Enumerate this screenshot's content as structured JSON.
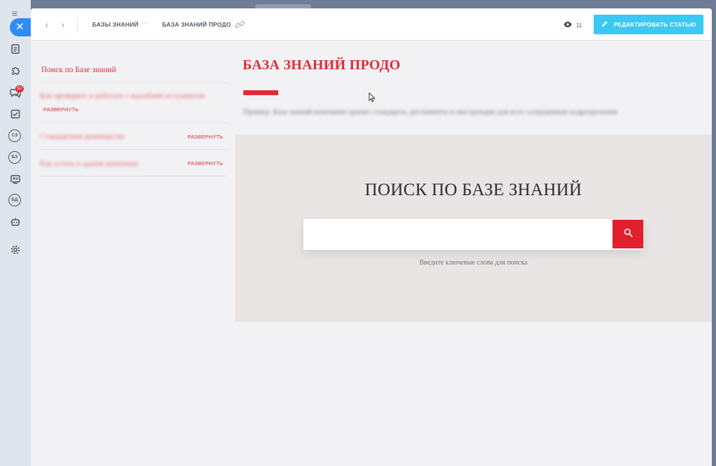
{
  "sidebar": {
    "chat_badge": "62",
    "items": [
      {
        "icon": "menu-icon"
      },
      {
        "icon": "close-icon"
      },
      {
        "icon": "document-icon"
      },
      {
        "icon": "puzzle-icon"
      },
      {
        "icon": "chat-icon"
      },
      {
        "icon": "tasks-icon"
      },
      {
        "label": "СЗ"
      },
      {
        "label": "БЗ"
      },
      {
        "icon": "contact-center-icon"
      },
      {
        "label": "БД"
      },
      {
        "icon": "robot-icon"
      },
      {
        "icon": "settings-icon"
      }
    ]
  },
  "topbar": {
    "breadcrumb": [
      "БАЗЫ ЗНАНИЙ",
      "БАЗА ЗНАНИЙ ПРОДО"
    ],
    "views_count": "11",
    "edit_button_label": "РЕДАКТИРОВАТЬ СТАТЬЮ"
  },
  "menu": {
    "items": [
      {
        "label": "Поиск по Базе знаний"
      },
      {
        "label": "Как проверять и работать с жалобами из клиентов",
        "action": "РАЗВЕРНУТЬ"
      },
      {
        "label": "Стандартные руководства",
        "action": "РАЗВЕРНУТЬ"
      },
      {
        "label": "Как устать в здание компании",
        "action": "РАЗВЕРНУТЬ"
      }
    ]
  },
  "article": {
    "title": "БАЗА ЗНАНИЙ ПРОДО",
    "description": "Пример: База знаний компании хранит стандарты, регламенты и инструкции для всех сотрудников подразделения"
  },
  "search": {
    "title": "ПОИСК ПО БАЗЕ ЗНАНИЙ",
    "placeholder": "",
    "hint": "Введите ключевые слова для поиска"
  },
  "colors": {
    "accent_red": "#e02b36",
    "edit_button": "#3bc8f5",
    "close_button": "#2f8cf5"
  }
}
